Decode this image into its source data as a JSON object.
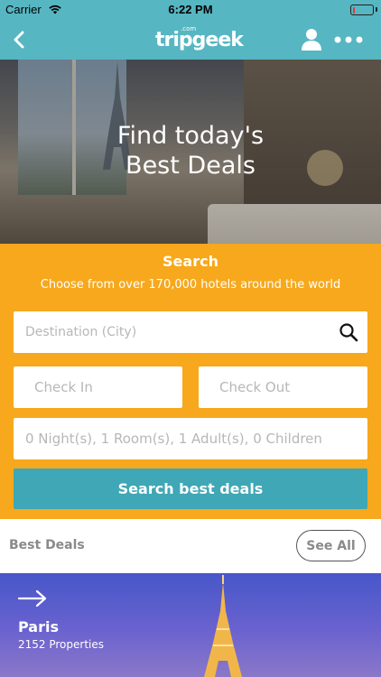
{
  "status_bar": {
    "carrier": "Carrier",
    "time": "6:22 PM",
    "battery_level": 0.12,
    "battery_color": "#e53935"
  },
  "nav": {
    "back_icon": "chevron-left-icon",
    "logo_text": "tripgeek",
    "logo_sub": ".com",
    "user_icon": "user-icon",
    "more_icon": "more-horizontal-icon",
    "bar_color": "#56b6c2"
  },
  "hero": {
    "title_line1": "Find today's",
    "title_line2": "Best Deals"
  },
  "search": {
    "heading": "Search",
    "subheading": "Choose from over 170,000 hotels around the world",
    "destination_placeholder": "Destination (City)",
    "destination_value": "",
    "check_in": "Check In",
    "check_out": "Check Out",
    "guests": "0 Night(s), 1 Room(s), 1 Adult(s), 0 Children",
    "button_label": "Search best deals",
    "panel_color": "#f7a81c",
    "button_color": "#3fa7b5"
  },
  "best_deals": {
    "title": "Best Deals",
    "see_all_label": "See All",
    "cards": [
      {
        "city": "Paris",
        "properties": "2152 Properties"
      }
    ]
  }
}
